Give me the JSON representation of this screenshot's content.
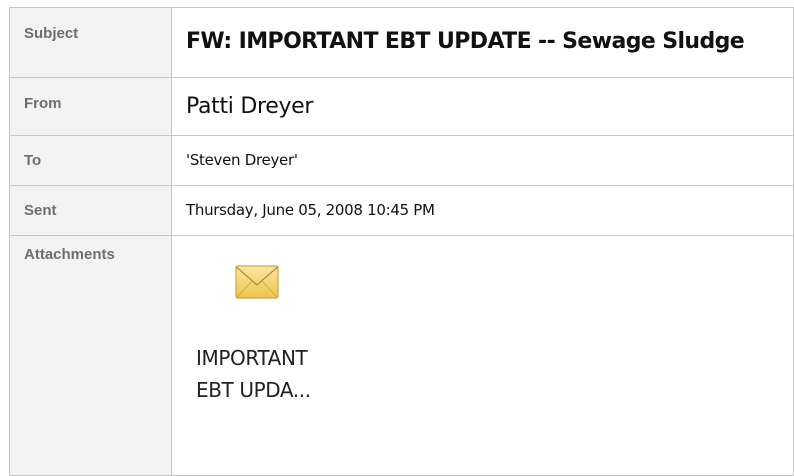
{
  "header": {
    "subject_label": "Subject",
    "subject_value": "FW: IMPORTANT EBT UPDATE -- Sewage Sludge",
    "from_label": "From",
    "from_value": "Patti Dreyer",
    "to_label": "To",
    "to_value": "'Steven Dreyer'",
    "sent_label": "Sent",
    "sent_value": "Thursday, June 05, 2008 10:45 PM",
    "attachments_label": "Attachments"
  },
  "attachments": [
    {
      "icon": "envelope-icon",
      "name_line1": "IMPORTANT",
      "name_line2": "EBT UPDA..."
    }
  ],
  "colors": {
    "label_background": "#f3f3f3",
    "label_text": "#6e6e6e",
    "border": "#c8c8c8",
    "envelope_fill": "#f6d36f"
  }
}
